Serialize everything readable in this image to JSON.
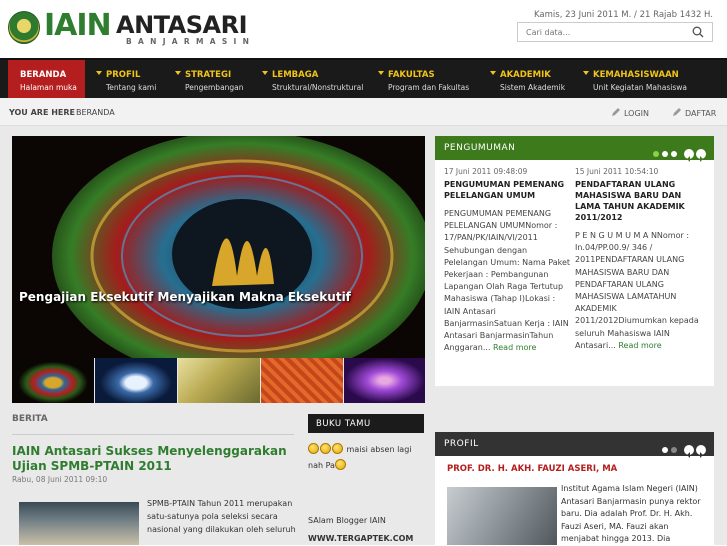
{
  "header": {
    "logo_iain": "IAIN",
    "logo_antasari": "ANTASARI",
    "logo_sub": "BANJARMASIN",
    "date": "Kamis, 23 Juni 2011 M.  /  21 Rajab 1432 H.",
    "search_placeholder": "Cari data..."
  },
  "nav": [
    {
      "label": "BERANDA",
      "sub": "Halaman muka"
    },
    {
      "label": "PROFIL",
      "sub": "Tentang kami"
    },
    {
      "label": "STRATEGI",
      "sub": "Pengembangan"
    },
    {
      "label": "LEMBAGA",
      "sub": "Struktural/Nonstruktural"
    },
    {
      "label": "FAKULTAS",
      "sub": "Program dan Fakultas"
    },
    {
      "label": "AKADEMIK",
      "sub": "Sistem Akademik"
    },
    {
      "label": "KEMAHASISWAAN",
      "sub": "Unit Kegiatan Mahasiswa"
    }
  ],
  "breadcrumb": {
    "label": "YOU ARE HERE",
    "page": "BERANDA",
    "login": "LOGIN",
    "daftar": "DAFTAR"
  },
  "slider": {
    "caption": "Pengajian Eksekutif Menyajikan Makna Eksekutif"
  },
  "pengumuman": {
    "title": "PENGUMUMAN",
    "items": [
      {
        "date": "17 Juni 2011 09:48:09",
        "title": "PENGUMUMAN PEMENANG PELELANGAN UMUM",
        "body": "PENGUMUMAN PEMENANG PELELANGAN UMUMNomor : 17/PAN/PK/IAIN/VI/2011 Sehubungan dengan Pelelangan Umum: Nama Paket Pekerjaan : Pembangunan Lapangan Olah Raga Tertutup Mahasiswa (Tahap I)Lokasi : IAIN Antasari BanjarmasinSatuan Kerja : IAIN Antasari BanjarmasinTahun Anggaran...",
        "more": "Read more"
      },
      {
        "date": "15 Juni 2011 10:54:10",
        "title": "PENDAFTARAN ULANG MAHASISWA BARU DAN LAMA TAHUN AKADEMIK 2011/2012",
        "body": "P E N G U M U M A NNomor : In.04/PP.00.9/ 346 / 2011PENDAFTARAN ULANG MAHASISWA  BARU DAN PENDAFTARAN  ULANG MAHASISWA  LAMATAHUN AKADEMIK 2011/2012Diumumkan kepada seluruh Mahasiswa IAIN Antasari...",
        "more": "Read more"
      }
    ]
  },
  "berita": {
    "section": "BERITA",
    "title": "IAIN Antasari Sukses Menyelenggarakan Ujian SPMB-PTAIN 2011",
    "date": "Rabu, 08 Juni 2011 09:10",
    "body": "SPMB-PTAIN Tahun 2011 merupakan satu-satunya pola seleksi secara nasional yang dilakukan oleh seluruh"
  },
  "bukutamu": {
    "title": "BUKU TAMU",
    "msg_a": "maisi absen lagi",
    "msg_b": "nah Pa",
    "msg2": "SAlam Blogger IAIN",
    "link": "WWW.TERGAPTEK.COM"
  },
  "profil": {
    "title": "PROFIL",
    "name": "PROF. DR. H. AKH. FAUZI ASERI, MA",
    "body": "Institut Agama Islam Negeri (IAIN) Antasari Banjarmasin punya rektor baru. Dia adalah Prof. Dr. H. Akh. Fauzi Aseri, MA. Fauzi akan menjabat hingga 2013. Dia"
  },
  "colors": {
    "brand_green": "#2f7d2f",
    "nav_active": "#b51e1e",
    "nav_label": "#f0c419",
    "panel_green": "#3d7a1c"
  }
}
